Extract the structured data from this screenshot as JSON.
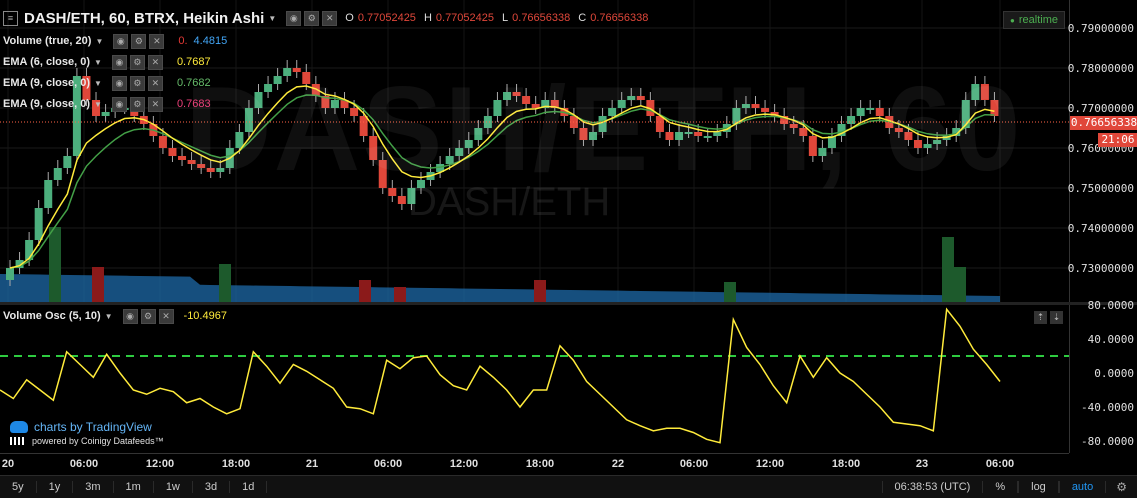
{
  "header": {
    "symbol_title": "DASH/ETH, 60, BTRX, Heikin Ashi",
    "ohlc": [
      {
        "key": "O",
        "value": "0.77052425"
      },
      {
        "key": "H",
        "value": "0.77052425"
      },
      {
        "key": "L",
        "value": "0.76656338"
      },
      {
        "key": "C",
        "value": "0.76656338"
      }
    ],
    "realtime_badge": "realtime"
  },
  "watermark": {
    "big": "DASH/ETH, 60",
    "small": "DASH/ETH"
  },
  "indicators": [
    {
      "name": "Volume (true, 20)",
      "values": [
        "0.",
        "4.4815"
      ],
      "colors": [
        "#e53935",
        "#42a5f5"
      ]
    },
    {
      "name": "EMA (6, close, 0)",
      "values": [
        "0.7687"
      ],
      "colors": [
        "#ffeb3b"
      ]
    },
    {
      "name": "EMA (9, close, 0)",
      "values": [
        "0.7682"
      ],
      "colors": [
        "#66bb6a"
      ]
    },
    {
      "name": "EMA (9, close, 0)",
      "values": [
        "0.7683"
      ],
      "colors": [
        "#ec407a"
      ]
    }
  ],
  "osc": {
    "name": "Volume Osc (5, 10)",
    "value": "-10.4967",
    "value_color": "#ffeb3b"
  },
  "price_axis": {
    "labels": [
      "0.79000000",
      "0.78000000",
      "0.77000000",
      "0.76000000",
      "0.75000000",
      "0.74000000",
      "0.73000000"
    ],
    "current_price": "0.76656338",
    "countdown": "21:06"
  },
  "osc_axis": {
    "labels": [
      "80.0000",
      "40.0000",
      "0.0000",
      "-40.0000",
      "-80.0000"
    ]
  },
  "time_axis": {
    "labels": [
      "20",
      "06:00",
      "12:00",
      "18:00",
      "21",
      "06:00",
      "12:00",
      "18:00",
      "22",
      "06:00",
      "12:00",
      "18:00",
      "23",
      "06:00"
    ]
  },
  "branding": {
    "line1": "charts by TradingView",
    "line2": "powered by Coinigy Datafeeds™"
  },
  "bottom_bar": {
    "timeframes": [
      "5y",
      "1y",
      "3m",
      "1m",
      "1w",
      "3d",
      "1d"
    ],
    "clock": "06:38:53 (UTC)",
    "toggles": [
      "%",
      "log",
      "auto"
    ]
  },
  "chart_data": {
    "type": "line",
    "series": [
      {
        "name": "Volume Osc (5, 10)",
        "values": [
          -20,
          -30,
          -8,
          -20,
          -32,
          25,
          10,
          -5,
          22,
          0,
          -20,
          -25,
          -18,
          -22,
          -35,
          -30,
          -40,
          -48,
          -42,
          25,
          8,
          -12,
          10,
          2,
          -8,
          -18,
          -40,
          -42,
          -48,
          15,
          5,
          18,
          20,
          -2,
          -15,
          -20,
          8,
          -5,
          -20,
          -40,
          -20,
          -20,
          32,
          15,
          -10,
          -25,
          -40,
          -55,
          -62,
          -68,
          -65,
          -65,
          -70,
          -78,
          -82,
          63,
          30,
          10,
          -15,
          -35,
          20,
          -5,
          18,
          0,
          -10,
          -25,
          -40,
          -58,
          -60,
          -62,
          -68,
          75,
          55,
          28,
          10,
          -10
        ]
      }
    ],
    "reference_lines": [
      20
    ],
    "ylim": [
      -90,
      80
    ]
  },
  "colors": {
    "up": "#4caf7d",
    "down": "#e0473a",
    "ema6": "#ffeb3b",
    "ema9": "#43a047",
    "osc_line": "#ffeb3b",
    "osc_dashed": "#2ecc40",
    "volume_area": "#1e6aa8",
    "price_line": "#ff6347"
  }
}
